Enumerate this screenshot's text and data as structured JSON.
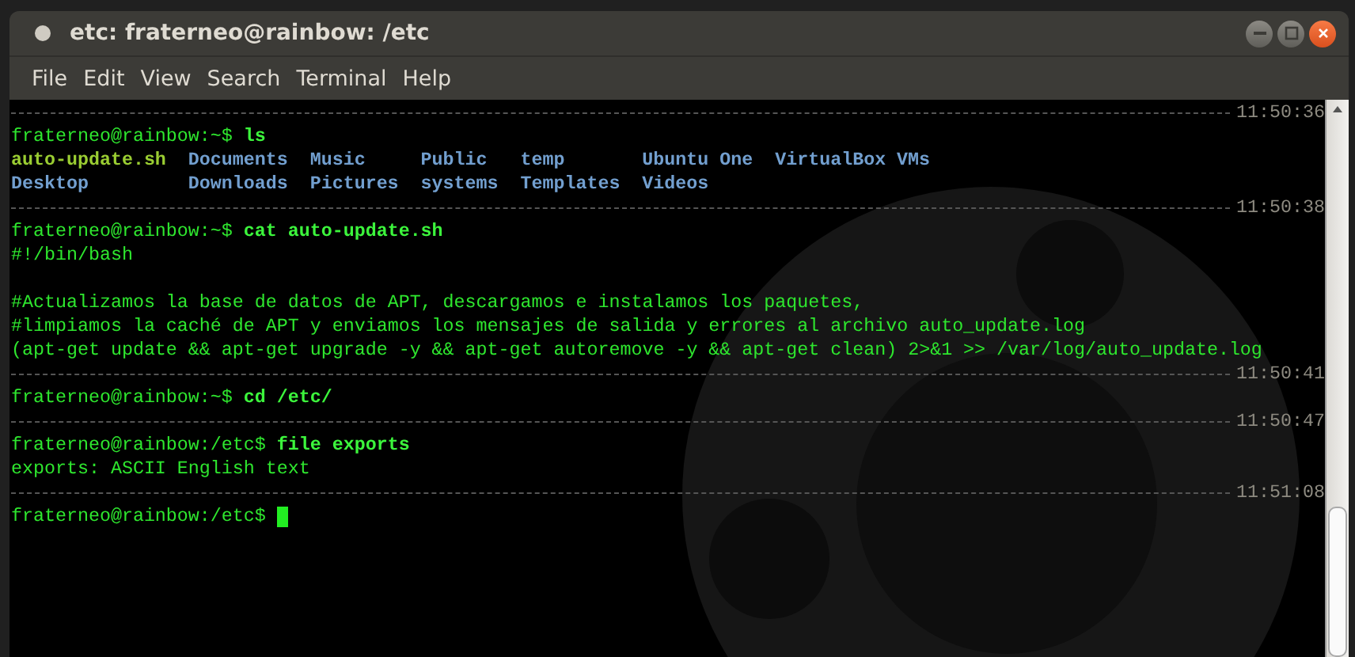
{
  "window": {
    "title": "etc: fraterneo@rainbow: /etc"
  },
  "menu": [
    "File",
    "Edit",
    "View",
    "Search",
    "Terminal",
    "Help"
  ],
  "lines": [
    {
      "kind": "separator",
      "timestamp": "11:50:36"
    },
    {
      "kind": "prompt",
      "prompt": "fraterneo@rainbow:~$",
      "command": "ls"
    },
    {
      "kind": "listing",
      "entries": [
        {
          "name": "auto-update.sh",
          "kind": "exec"
        },
        {
          "name": "Documents",
          "kind": "dir"
        },
        {
          "name": "Music",
          "kind": "dir"
        },
        {
          "name": "Public",
          "kind": "dir"
        },
        {
          "name": "temp",
          "kind": "dir"
        },
        {
          "name": "Ubuntu One",
          "kind": "dir"
        },
        {
          "name": "VirtualBox VMs",
          "kind": "dir"
        }
      ]
    },
    {
      "kind": "listing",
      "entries": [
        {
          "name": "Desktop",
          "kind": "dir"
        },
        {
          "name": "Downloads",
          "kind": "dir"
        },
        {
          "name": "Pictures",
          "kind": "dir"
        },
        {
          "name": "systems",
          "kind": "dir"
        },
        {
          "name": "Templates",
          "kind": "dir"
        },
        {
          "name": "Videos",
          "kind": "dir"
        }
      ]
    },
    {
      "kind": "separator",
      "timestamp": "11:50:38"
    },
    {
      "kind": "prompt",
      "prompt": "fraterneo@rainbow:~$",
      "command": "cat auto-update.sh"
    },
    {
      "kind": "output",
      "text": "#!/bin/bash"
    },
    {
      "kind": "blank"
    },
    {
      "kind": "output",
      "text": "#Actualizamos la base de datos de APT, descargamos e instalamos los paquetes,"
    },
    {
      "kind": "output",
      "text": "#limpiamos la caché de APT y enviamos los mensajes de salida y errores al archivo auto_update.log"
    },
    {
      "kind": "output",
      "text": "(apt-get update && apt-get upgrade -y && apt-get autoremove -y && apt-get clean) 2>&1 >> /var/log/auto_update.log"
    },
    {
      "kind": "separator",
      "timestamp": "11:50:41"
    },
    {
      "kind": "prompt",
      "prompt": "fraterneo@rainbow:~$",
      "command": "cd /etc/"
    },
    {
      "kind": "separator",
      "timestamp": "11:50:47"
    },
    {
      "kind": "prompt",
      "prompt": "fraterneo@rainbow:/etc$",
      "command": "file exports"
    },
    {
      "kind": "output",
      "text": "exports: ASCII English text"
    },
    {
      "kind": "separator",
      "timestamp": "11:51:08"
    },
    {
      "kind": "prompt",
      "prompt": "fraterneo@rainbow:/etc$",
      "cursor": true
    }
  ]
}
